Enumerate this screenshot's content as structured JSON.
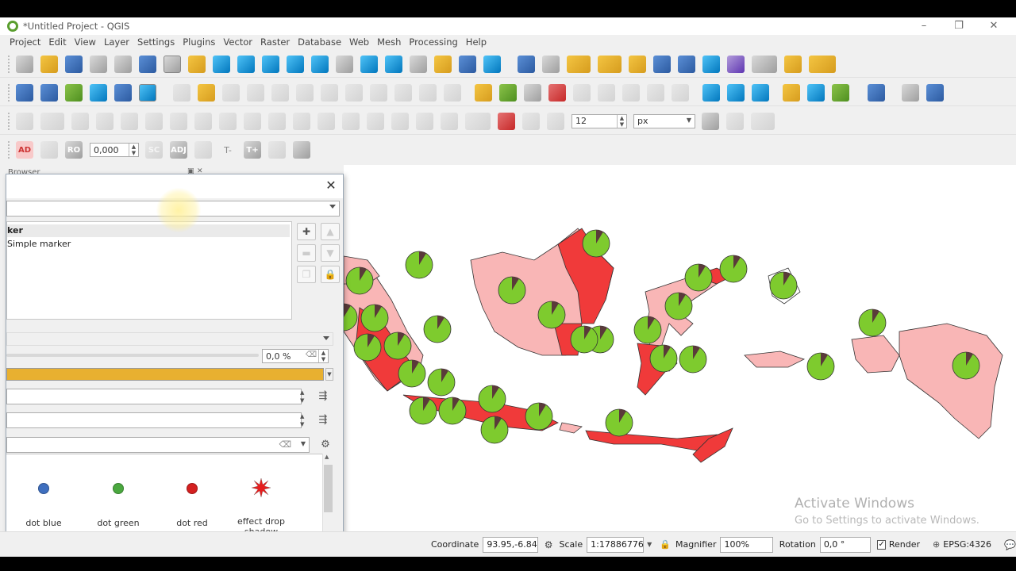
{
  "window": {
    "title": "*Untitled Project - QGIS"
  },
  "menu": [
    "Project",
    "Edit",
    "View",
    "Layer",
    "Settings",
    "Plugins",
    "Vector",
    "Raster",
    "Database",
    "Web",
    "Mesh",
    "Processing",
    "Help"
  ],
  "toolbar": {
    "font_size_value": "12",
    "font_unit_value": "px",
    "label_offset_value": "0,000",
    "label_buttons": [
      "AD",
      "RO",
      "SC",
      "ADJ",
      "T+"
    ]
  },
  "browser_panel": {
    "title": "Browser"
  },
  "symbol_dialog": {
    "layer_tree": {
      "root_label": "ker",
      "child_label": "Simple marker"
    },
    "opacity_value": "0,0 %",
    "accent_color": "#e8b030",
    "symbols": [
      {
        "label": "dot blue",
        "color": "#3f6fbf"
      },
      {
        "label": "dot green",
        "color": "#4aa83f"
      },
      {
        "label": "dot red",
        "color": "#d42020"
      },
      {
        "label": "effect drop shadow",
        "color": "#e61e1e"
      }
    ]
  },
  "map": {
    "watermark_title": "Activate Windows",
    "watermark_subtitle": "Go to Settings to activate Windows.",
    "colors": {
      "dark": "#f03a3a",
      "light": "#f9b6b6",
      "pie_green": "#7ecb2e",
      "pie_slice": "#5a3a3a"
    }
  },
  "statusbar": {
    "coordinate_label": "Coordinate",
    "coordinate_value": "93.95,-6.84",
    "scale_label": "Scale",
    "scale_value": "1:17886776",
    "magnifier_label": "Magnifier",
    "magnifier_value": "100%",
    "rotation_label": "Rotation",
    "rotation_value": "0,0 °",
    "render_label": "Render",
    "crs_value": "EPSG:4326"
  }
}
